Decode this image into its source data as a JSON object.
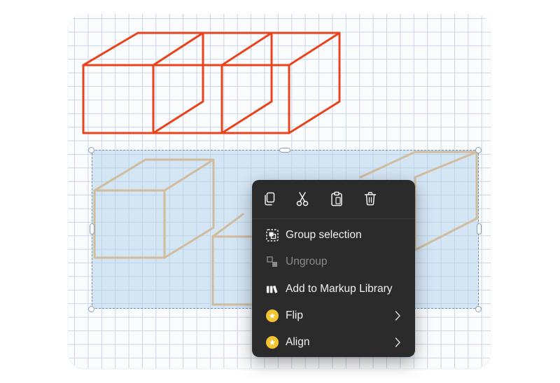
{
  "colors": {
    "red_cubes": "#e8431c",
    "orange_cubes": "#f4a340",
    "menu_bg": "#2b2b2b",
    "menu_text": "#f2f2f2",
    "disabled_text": "#8a8a8a",
    "badge": "#f4c430"
  },
  "toolbar": {
    "copy_icon": "copy-icon",
    "cut_icon": "scissors-icon",
    "paste_icon": "clipboard-icon",
    "delete_icon": "trash-icon"
  },
  "menu": {
    "items": [
      {
        "label": "Group selection",
        "icon": "group-icon",
        "enabled": true
      },
      {
        "label": "Ungroup",
        "icon": "ungroup-icon",
        "enabled": false
      },
      {
        "label": "Add to Markup Library",
        "icon": "library-icon",
        "enabled": true
      },
      {
        "label": "Flip",
        "icon": "star-badge-icon",
        "enabled": true,
        "submenu": true
      },
      {
        "label": "Align",
        "icon": "star-badge-icon",
        "enabled": true,
        "submenu": true
      }
    ]
  }
}
